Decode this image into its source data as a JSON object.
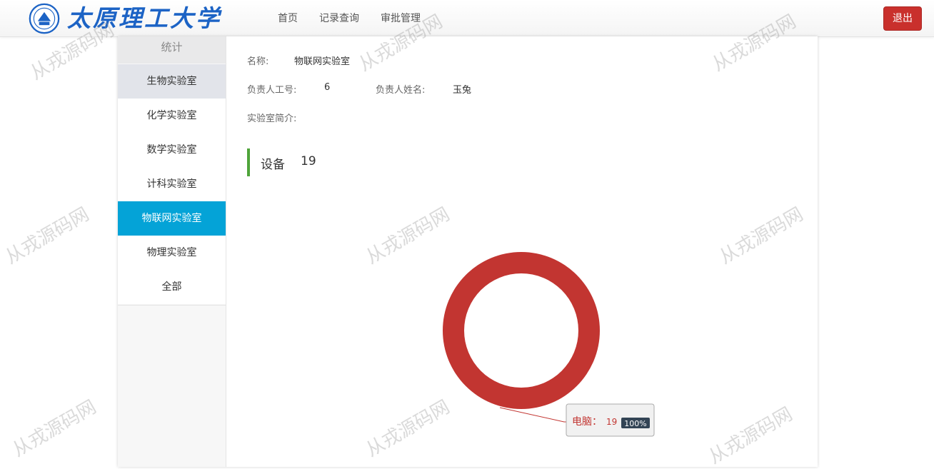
{
  "header": {
    "brand_text": "太原理工大学",
    "nav": [
      "首页",
      "记录查询",
      "审批管理"
    ],
    "logout_label": "退出"
  },
  "sidebar": {
    "title": "统计",
    "items": [
      {
        "label": "生物实验室",
        "state": "hover"
      },
      {
        "label": "化学实验室",
        "state": "normal"
      },
      {
        "label": "数学实验室",
        "state": "normal"
      },
      {
        "label": "计科实验室",
        "state": "normal"
      },
      {
        "label": "物联网实验室",
        "state": "active"
      },
      {
        "label": "物理实验室",
        "state": "normal"
      },
      {
        "label": "全部",
        "state": "normal"
      }
    ]
  },
  "lab_info": {
    "name_label": "名称:",
    "name_value": "物联网实验室",
    "manager_id_label": "负责人工号:",
    "manager_id_value": "6",
    "manager_name_label": "负责人姓名:",
    "manager_name_value": "玉兔",
    "intro_label": "实验室简介:",
    "intro_value": ""
  },
  "equipment": {
    "title": "设备",
    "count": "19"
  },
  "chart_data": {
    "type": "pie",
    "variant": "donut",
    "slices": [
      {
        "name": "电脑",
        "value": 19,
        "percent": "100%",
        "color": "#c23531"
      }
    ],
    "label": {
      "name": "电脑",
      "value": "19",
      "percent": "100%"
    }
  },
  "watermark": "从戎源码网",
  "colors": {
    "accent": "#04a3d7",
    "logout": "#c9302c",
    "section_bar": "#4fa43a",
    "brand": "#1c63c5"
  }
}
